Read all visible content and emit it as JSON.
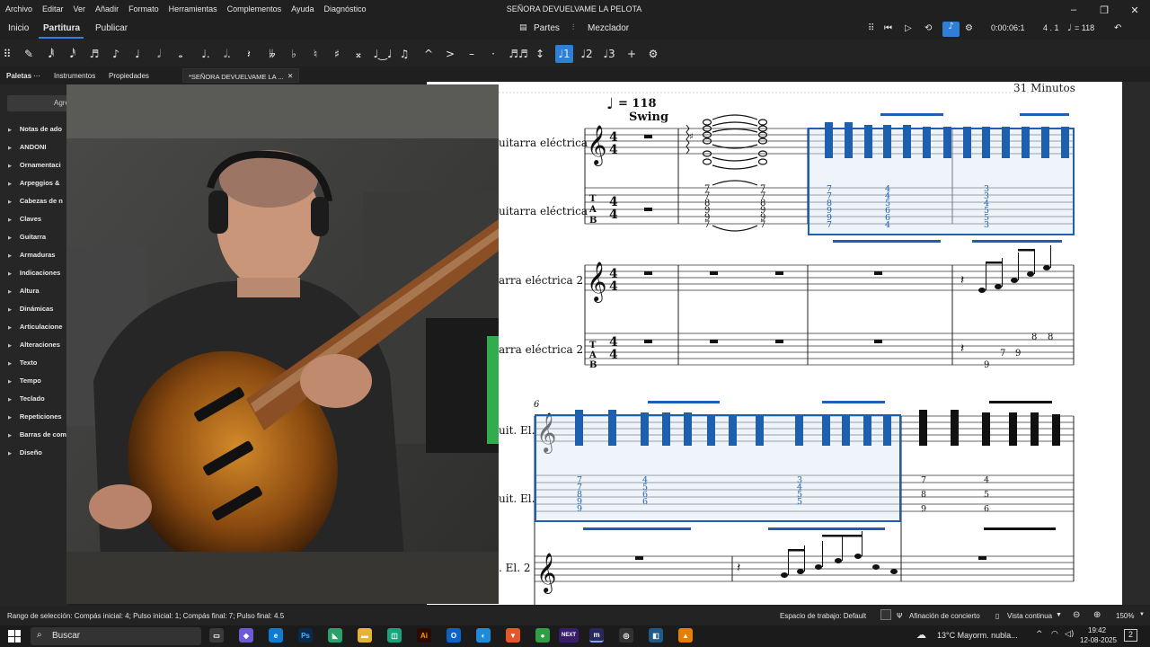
{
  "window": {
    "title": "SEÑORA DEVUELVAME LA PELOTA",
    "menu": [
      "Archivo",
      "Editar",
      "Ver",
      "Añadir",
      "Formato",
      "Herramientas",
      "Complementos",
      "Ayuda",
      "Diagnóstico"
    ],
    "controls": [
      "minimize",
      "maximize",
      "close"
    ]
  },
  "tabs": {
    "inicio": "Inicio",
    "partitura": "Partitura",
    "publicar": "Publicar",
    "partes": "Partes",
    "mezclador": "Mezclador"
  },
  "playback": {
    "time": "0:00:06:1",
    "position": "4 . 1",
    "tempo": "= 118"
  },
  "panel_tabs": {
    "paletas": "Paletas",
    "instrumentos": "Instrumentos",
    "propiedades": "Propiedades",
    "document_tab": "*SEÑORA DEVUELVAME LA ..."
  },
  "palettes": {
    "search_label": "Agre",
    "items": [
      "Notas de ado",
      "ANDONI",
      "Ornamentaci",
      "Arpeggios &",
      "Cabezas de n",
      "Claves",
      "Guitarra",
      "Armaduras",
      "Indicaciones",
      "Altura",
      "Dinámicas",
      "Articulacione",
      "Alteraciones",
      "Texto",
      "Tempo",
      "Teclado",
      "Repeticiones",
      "Barras de com",
      "Diseño"
    ]
  },
  "score": {
    "composer": "31 Minutos",
    "tempo_marking": "= 118",
    "style_text": "Swing",
    "measure_number": "6",
    "staff_labels": [
      "uitarra eléctrica",
      "uitarra eléctrica",
      "arra eléctrica 2",
      "arra eléctrica 2",
      "uit. El.",
      "uit. El.",
      ". El. 2"
    ],
    "time_signature": "4/4",
    "tab_clef": "TAB",
    "tab_frets_chord_a": [
      "7",
      "7",
      "8",
      "9",
      "9",
      "7"
    ],
    "tab_frets_chord_b": [
      "7",
      "7",
      "8",
      "9",
      "9",
      "7"
    ],
    "tab_frets_selected": [
      "7",
      "7",
      "8",
      "9",
      "9",
      "7",
      "4",
      "4",
      "5",
      "6",
      "6",
      "4",
      "3",
      "3",
      "4",
      "5",
      "5",
      "3"
    ],
    "tab_frets_guitar2": [
      "9",
      "7",
      "9",
      "8",
      "8"
    ]
  },
  "status": {
    "selection": "Rango de selección: Compás inicial: 4; Pulso inicial: 1; Compás final: 7; Pulso final: 4.5",
    "workspace": "Espacio de trabajo: Default",
    "concert_pitch": "Afinación de concierto",
    "view_mode": "Vista continua",
    "zoom": "150%"
  },
  "taskbar": {
    "search": "Buscar",
    "weather": "13°C  Mayorm. nubla...",
    "time": "19:42",
    "date": "12-08-2025",
    "notifications": "2",
    "app_icons": [
      "task-view",
      "copilot",
      "edge",
      "photoshop",
      "clip",
      "explorer",
      "store",
      "illustrator",
      "outlook",
      "edge-browser",
      "brave",
      "chrome",
      "next",
      "musescore",
      "obs",
      "app",
      "vlc"
    ]
  },
  "colors": {
    "accent": "#2f80e0",
    "selection": "#1e5fb0"
  }
}
